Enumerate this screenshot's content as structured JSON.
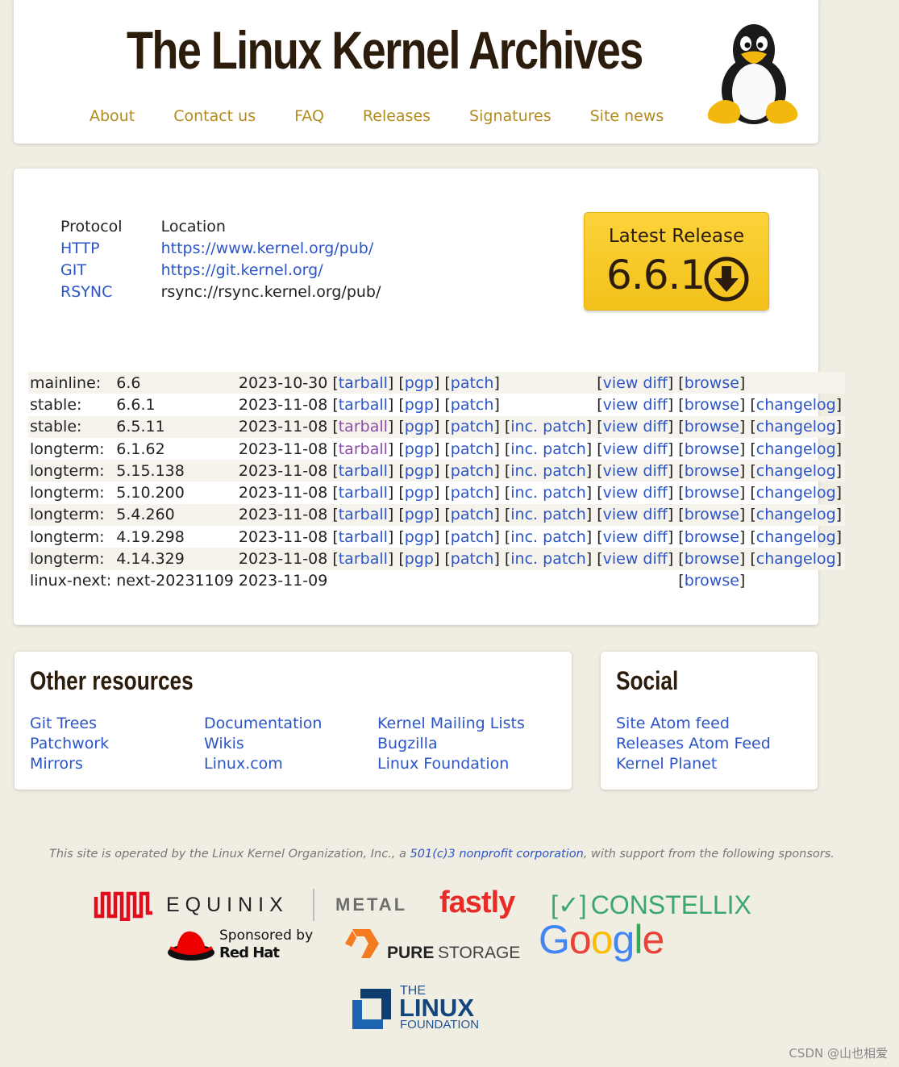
{
  "header": {
    "title": "The Linux Kernel Archives",
    "nav": [
      "About",
      "Contact us",
      "FAQ",
      "Releases",
      "Signatures",
      "Site news"
    ]
  },
  "protocols": {
    "col_protocol": "Protocol",
    "col_location": "Location",
    "rows": [
      {
        "protocol": "HTTP",
        "location": "https://www.kernel.org/pub/",
        "linked": true
      },
      {
        "protocol": "GIT",
        "location": "https://git.kernel.org/",
        "linked": true
      },
      {
        "protocol": "RSYNC",
        "location": "rsync://rsync.kernel.org/pub/",
        "linked": false
      }
    ]
  },
  "latest": {
    "label": "Latest Release",
    "version": "6.6.1",
    "icon": "download-arrow-circle-icon"
  },
  "releases": [
    {
      "branch": "mainline:",
      "version": "6.6",
      "date": "2023-10-30",
      "tarball": "tarball",
      "pgp": "pgp",
      "patch": "patch",
      "inc": "",
      "diff": "view diff",
      "browse": "browse",
      "changelog": "",
      "tarball_visited": false
    },
    {
      "branch": "stable:",
      "version": "6.6.1",
      "date": "2023-11-08",
      "tarball": "tarball",
      "pgp": "pgp",
      "patch": "patch",
      "inc": "",
      "diff": "view diff",
      "browse": "browse",
      "changelog": "changelog",
      "tarball_visited": false
    },
    {
      "branch": "stable:",
      "version": "6.5.11",
      "date": "2023-11-08",
      "tarball": "tarball",
      "pgp": "pgp",
      "patch": "patch",
      "inc": "inc. patch",
      "diff": "view diff",
      "browse": "browse",
      "changelog": "changelog",
      "tarball_visited": true
    },
    {
      "branch": "longterm:",
      "version": "6.1.62",
      "date": "2023-11-08",
      "tarball": "tarball",
      "pgp": "pgp",
      "patch": "patch",
      "inc": "inc. patch",
      "diff": "view diff",
      "browse": "browse",
      "changelog": "changelog",
      "tarball_visited": true
    },
    {
      "branch": "longterm:",
      "version": "5.15.138",
      "date": "2023-11-08",
      "tarball": "tarball",
      "pgp": "pgp",
      "patch": "patch",
      "inc": "inc. patch",
      "diff": "view diff",
      "browse": "browse",
      "changelog": "changelog",
      "tarball_visited": false
    },
    {
      "branch": "longterm:",
      "version": "5.10.200",
      "date": "2023-11-08",
      "tarball": "tarball",
      "pgp": "pgp",
      "patch": "patch",
      "inc": "inc. patch",
      "diff": "view diff",
      "browse": "browse",
      "changelog": "changelog",
      "tarball_visited": false
    },
    {
      "branch": "longterm:",
      "version": "5.4.260",
      "date": "2023-11-08",
      "tarball": "tarball",
      "pgp": "pgp",
      "patch": "patch",
      "inc": "inc. patch",
      "diff": "view diff",
      "browse": "browse",
      "changelog": "changelog",
      "tarball_visited": false
    },
    {
      "branch": "longterm:",
      "version": "4.19.298",
      "date": "2023-11-08",
      "tarball": "tarball",
      "pgp": "pgp",
      "patch": "patch",
      "inc": "inc. patch",
      "diff": "view diff",
      "browse": "browse",
      "changelog": "changelog",
      "tarball_visited": false
    },
    {
      "branch": "longterm:",
      "version": "4.14.329",
      "date": "2023-11-08",
      "tarball": "tarball",
      "pgp": "pgp",
      "patch": "patch",
      "inc": "inc. patch",
      "diff": "view diff",
      "browse": "browse",
      "changelog": "changelog",
      "tarball_visited": false
    },
    {
      "branch": "linux-next:",
      "version": "next-20231109",
      "date": "2023-11-09",
      "tarball": "",
      "pgp": "",
      "patch": "",
      "inc": "",
      "diff": "",
      "browse": "browse",
      "changelog": "",
      "tarball_visited": false
    }
  ],
  "other_resources": {
    "title": "Other resources",
    "columns": [
      [
        "Git Trees",
        "Patchwork",
        "Mirrors"
      ],
      [
        "Documentation",
        "Wikis",
        "Linux.com"
      ],
      [
        "Kernel Mailing Lists",
        "Bugzilla",
        "Linux Foundation"
      ]
    ]
  },
  "social": {
    "title": "Social",
    "links": [
      "Site Atom feed",
      "Releases Atom Feed",
      "Kernel Planet"
    ]
  },
  "footer": {
    "prefix": "This site is operated by the Linux Kernel Organization, Inc., a ",
    "link": "501(c)3 nonprofit corporation",
    "suffix": ", with support from the following sponsors."
  },
  "sponsors": {
    "equinix": "EQUINIX",
    "metal": "METAL",
    "fastly": "fastly",
    "constellix": "CONSTELLIX",
    "constellix_mark": "[✓]",
    "redhat_sponsored": "Sponsored by",
    "redhat": "Red Hat",
    "pure": "PURE",
    "storage": "STORAGE",
    "google": [
      "G",
      "o",
      "o",
      "g",
      "l",
      "e"
    ],
    "lf_the": "THE",
    "lf_linux": "LINUX",
    "lf_foundation": "FOUNDATION"
  },
  "colors": {
    "nav": "#b38a1e",
    "link": "#2b55c8",
    "visited": "#8a4aa8",
    "heading": "#2c1c0c",
    "latest_bg": "#f7c72a",
    "page_bg": "#f0ede2"
  },
  "watermark": "CSDN @山也相爱"
}
